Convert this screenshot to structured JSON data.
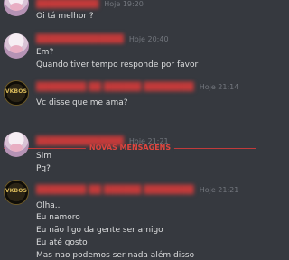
{
  "colors": {
    "background": "#36393f",
    "username": "#c23a3a",
    "timestamp": "#72767d",
    "text": "#dcddde",
    "new_messages": "#e2463f"
  },
  "messages": [
    {
      "username": "",
      "time": "Hoje 19:20",
      "lines": [
        "Oi tá melhor ?"
      ]
    },
    {
      "username": "",
      "time": "Hoje 20:40",
      "lines": [
        "Em?",
        "Quando tiver tempo responde por favor"
      ]
    },
    {
      "username": "",
      "avatar_text": "VKBOS",
      "time": "Hoje 21:14",
      "lines": [
        "Vc disse que me ama?"
      ]
    },
    {
      "username": "",
      "time": "Hoje 21:21",
      "lines": [
        "Sim",
        "Pq?"
      ]
    },
    {
      "username": "",
      "avatar_text": "VKBOS",
      "time": "Hoje 21:21",
      "lines": [
        "Olha..",
        "Eu namoro",
        "Eu não ligo da gente ser amigo",
        "Eu até gosto",
        "Mas nao podemos ser nada além disso"
      ]
    }
  ],
  "new_messages_label": "NOVAS MENSAGENS"
}
